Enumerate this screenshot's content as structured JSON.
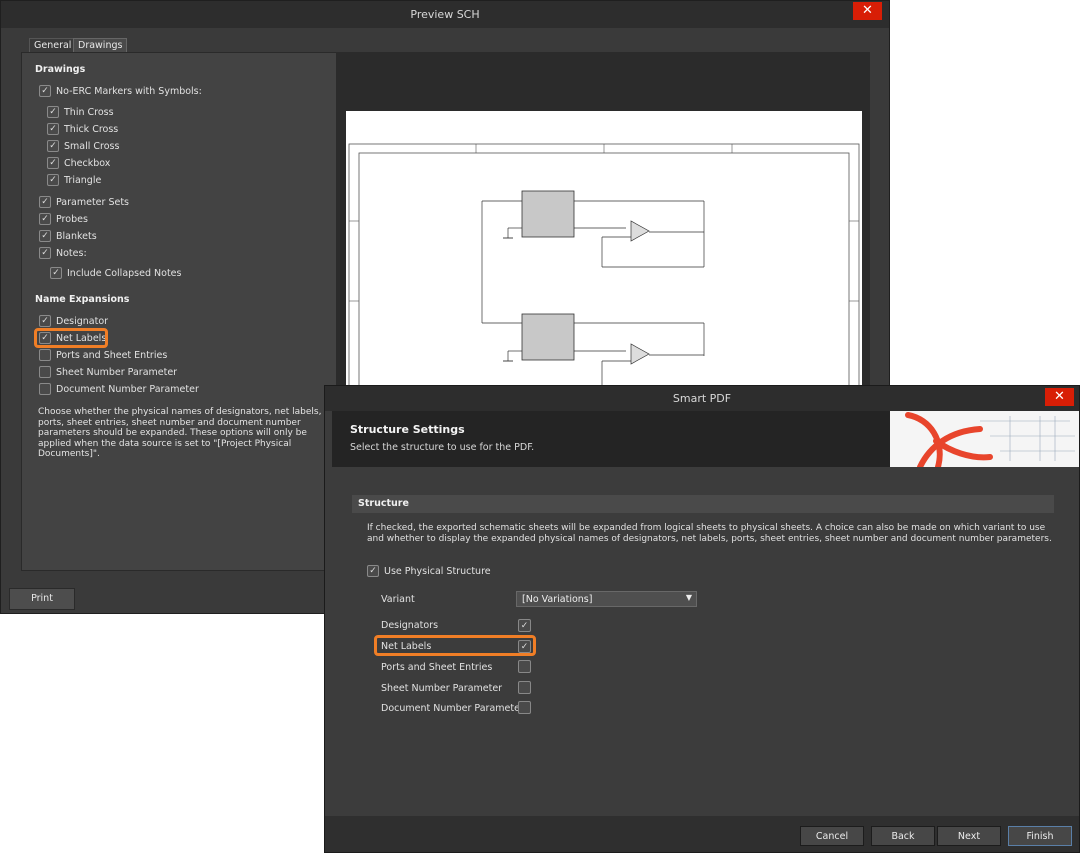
{
  "preview_window": {
    "title": "Preview SCH",
    "close_glyph": "✕",
    "tabs": [
      {
        "label": "General"
      },
      {
        "label": "Drawings"
      }
    ],
    "drawings": {
      "section_title": "Drawings",
      "no_erc_label": "No-ERC Markers with Symbols:",
      "no_erc_items": [
        "Thin Cross",
        "Thick Cross",
        "Small Cross",
        "Checkbox",
        "Triangle"
      ],
      "other_items": [
        "Parameter Sets",
        "Probes",
        "Blankets",
        "Notes:"
      ],
      "notes_sub": "Include Collapsed Notes"
    },
    "name_expansions": {
      "section_title": "Name Expansions",
      "items": [
        {
          "label": "Designator",
          "checked": true
        },
        {
          "label": "Net Labels",
          "checked": true
        },
        {
          "label": "Ports and Sheet Entries",
          "checked": false
        },
        {
          "label": "Sheet Number Parameter",
          "checked": false
        },
        {
          "label": "Document Number Parameter",
          "checked": false
        }
      ]
    },
    "description": "Choose whether the physical names of designators, net labels, ports, sheet entries, sheet number and document number parameters should be expanded. These options will only be applied when the data source is set to \"[Project Physical Documents]\".",
    "print_label": "Print",
    "highlight_color": "#f07e26"
  },
  "smart_pdf": {
    "title": "Smart PDF",
    "close_glyph": "✕",
    "header_title": "Structure Settings",
    "header_subtitle": "Select the structure to use for the PDF.",
    "section_title": "Structure",
    "description": "If checked, the exported schematic sheets will be expanded from logical sheets to physical sheets. A choice can also be made on which variant to use and whether to display the expanded physical names of designators, net labels, ports, sheet entries, sheet number and document number parameters.",
    "use_physical_label": "Use Physical Structure",
    "variant_label": "Variant",
    "variant_value": "[No Variations]",
    "options": [
      {
        "label": "Designators",
        "checked": true
      },
      {
        "label": "Net Labels",
        "checked": true
      },
      {
        "label": "Ports and Sheet Entries",
        "checked": false
      },
      {
        "label": "Sheet Number Parameter",
        "checked": false
      },
      {
        "label": "Document Number Parameter",
        "checked": false
      }
    ],
    "buttons": {
      "cancel": "Cancel",
      "back": "Back",
      "next": "Next",
      "finish": "Finish"
    },
    "accent_color": "#e8452c"
  },
  "icons": {
    "check": "✓",
    "dropdown": "▼"
  }
}
